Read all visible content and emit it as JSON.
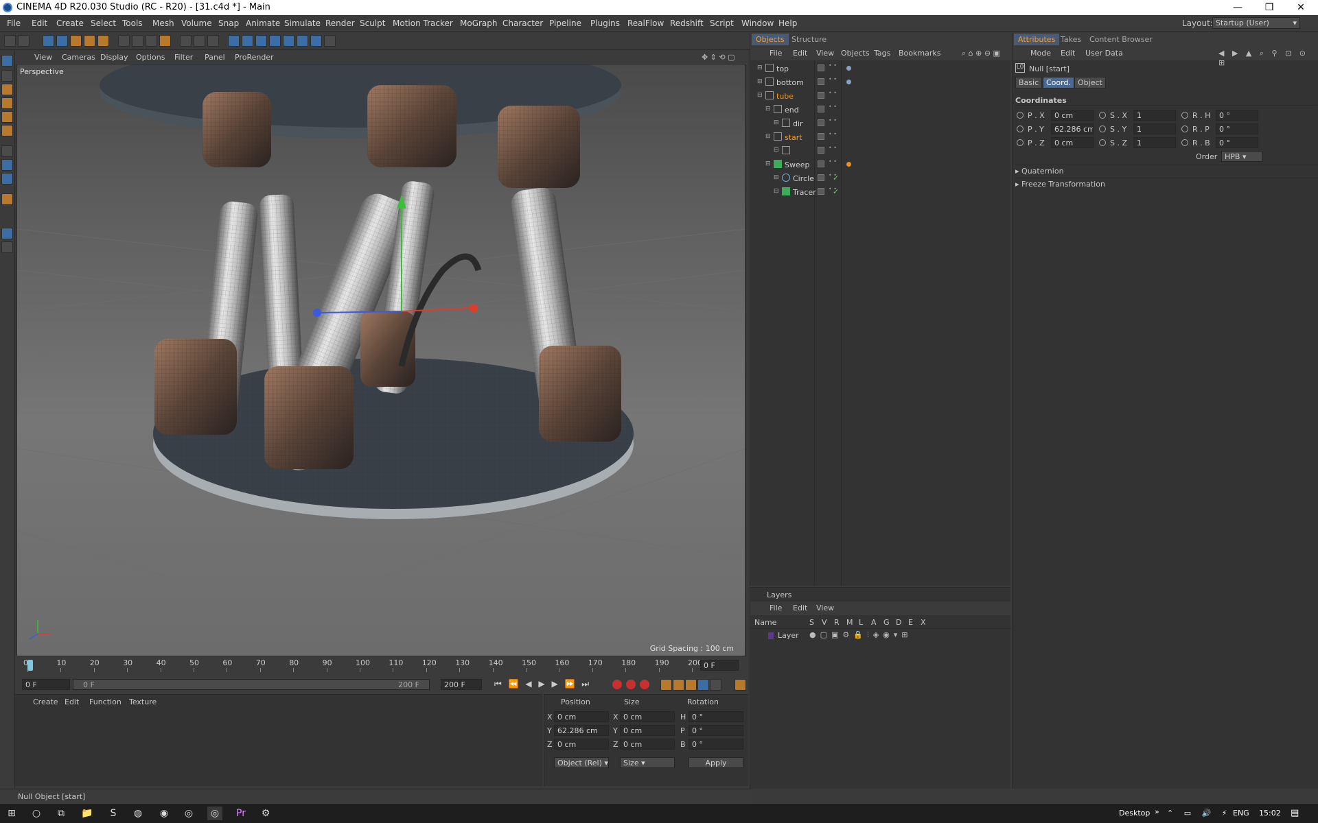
{
  "window": {
    "title": "CINEMA 4D R20.030 Studio (RC - R20) - [31.c4d *] - Main",
    "minimize": "—",
    "maximize": "❐",
    "close": "✕"
  },
  "menubar": {
    "items": [
      "File",
      "Edit",
      "Create",
      "Select",
      "Tools",
      "Mesh",
      "Volume",
      "Snap",
      "Animate",
      "Simulate",
      "Render",
      "Sculpt",
      "Motion Tracker",
      "MoGraph",
      "Character",
      "Pipeline",
      "Plugins",
      "RealFlow",
      "Redshift",
      "Script",
      "Window",
      "Help"
    ],
    "layout_label": "Layout:",
    "layout_value": "Startup (User)"
  },
  "viewport": {
    "menu": [
      "View",
      "Cameras",
      "Display",
      "Options",
      "Filter",
      "Panel",
      "ProRender"
    ],
    "camera_label": "Perspective",
    "grid_spacing": "Grid Spacing : 100 cm"
  },
  "timeline": {
    "ticks": [
      "0",
      "10",
      "20",
      "30",
      "40",
      "50",
      "60",
      "70",
      "80",
      "90",
      "100",
      "110",
      "120",
      "130",
      "140",
      "150",
      "160",
      "170",
      "180",
      "190",
      "200"
    ],
    "current_frame_right": "0 F",
    "start_frame": "0 F",
    "slider_start": "0 F",
    "slider_end": "200 F",
    "end_frame": "200 F"
  },
  "material_manager": {
    "menu": [
      "Create",
      "Edit",
      "Function",
      "Texture"
    ]
  },
  "coord_manager": {
    "headers": [
      "Position",
      "Size",
      "Rotation"
    ],
    "rows": [
      {
        "axis": "X",
        "pos": "0 cm",
        "saxis": "X",
        "size": "0 cm",
        "raxis": "H",
        "rot": "0 °"
      },
      {
        "axis": "Y",
        "pos": "62.286 cm",
        "saxis": "Y",
        "size": "0 cm",
        "raxis": "P",
        "rot": "0 °"
      },
      {
        "axis": "Z",
        "pos": "0 cm",
        "saxis": "Z",
        "size": "0 cm",
        "raxis": "B",
        "rot": "0 °"
      }
    ],
    "mode_select": "Object (Rel)",
    "size_select": "Size",
    "apply": "Apply"
  },
  "object_manager": {
    "tabs": [
      "Objects",
      "Structure"
    ],
    "menu": [
      "File",
      "Edit",
      "View",
      "Objects",
      "Tags",
      "Bookmarks"
    ],
    "objects": [
      {
        "name": "top",
        "indent": 0,
        "color": "#d0d0d0",
        "icon": "null-icon",
        "tag": "dot"
      },
      {
        "name": "bottom",
        "indent": 0,
        "color": "#d0d0d0",
        "icon": "null-icon",
        "tag": "dot"
      },
      {
        "name": "tube",
        "indent": 0,
        "color": "#e89020",
        "icon": "null-icon",
        "tag": ""
      },
      {
        "name": "end",
        "indent": 1,
        "color": "#d0d0d0",
        "icon": "null-icon",
        "tag": ""
      },
      {
        "name": "dir",
        "indent": 2,
        "color": "#d0d0d0",
        "icon": "null-icon",
        "tag": ""
      },
      {
        "name": "start",
        "indent": 1,
        "color": "#f5a030",
        "icon": "null-icon",
        "tag": ""
      },
      {
        "name": "",
        "indent": 2,
        "color": "#d0d0d0",
        "icon": "null-icon",
        "tag": ""
      },
      {
        "name": "Sweep",
        "indent": 1,
        "color": "#d0d0d0",
        "icon": "sweep-icon",
        "tag": "orange"
      },
      {
        "name": "Circle",
        "indent": 2,
        "color": "#d0d0d0",
        "icon": "circle-spline-icon",
        "tag": "check"
      },
      {
        "name": "Tracer",
        "indent": 2,
        "color": "#d0d0d0",
        "icon": "tracer-icon",
        "tag": "check"
      }
    ]
  },
  "layers": {
    "title": "Layers",
    "menu": [
      "File",
      "Edit",
      "View"
    ],
    "columns": [
      "Name",
      "S",
      "V",
      "R",
      "M",
      "L",
      "A",
      "G",
      "D",
      "E",
      "X"
    ],
    "row_name": "Layer"
  },
  "attributes": {
    "tabs": [
      "Attributes",
      "Takes",
      "Content Browser"
    ],
    "menu": [
      "Mode",
      "Edit",
      "User Data"
    ],
    "object_name": "Null [start]",
    "subtabs": [
      "Basic",
      "Coord.",
      "Object"
    ],
    "section": "Coordinates",
    "coords": [
      {
        "p_label": "P . X",
        "p": "0 cm",
        "s_label": "S . X",
        "s": "1",
        "r_label": "R . H",
        "r": "0 °"
      },
      {
        "p_label": "P . Y",
        "p": "62.286 cm",
        "s_label": "S . Y",
        "s": "1",
        "r_label": "R . P",
        "r": "0 °"
      },
      {
        "p_label": "P . Z",
        "p": "0 cm",
        "s_label": "S . Z",
        "s": "1",
        "r_label": "R . B",
        "r": "0 °"
      }
    ],
    "order_label": "Order",
    "order_value": "HPB",
    "collapsed": [
      "Quaternion",
      "Freeze Transformation"
    ]
  },
  "statusbar": {
    "text": "Null Object [start]"
  },
  "taskbar": {
    "desktop": "Desktop",
    "chevron": "»",
    "lang": "ENG",
    "time": "15:02"
  }
}
